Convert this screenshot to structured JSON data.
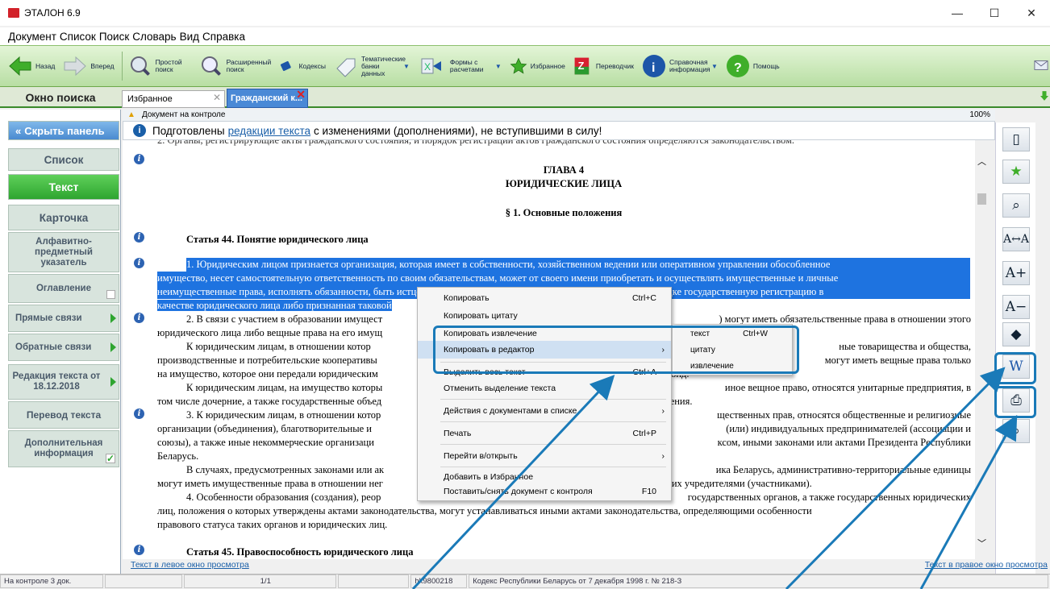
{
  "window": {
    "title": "ЭТАЛОН 6.9",
    "minimize": "—",
    "maximize": "☐",
    "close": "✕"
  },
  "menu": [
    "Документ",
    "Список",
    "Поиск",
    "Словарь",
    "Вид",
    "Справка"
  ],
  "toolbar": {
    "back": "Назад",
    "forward": "Вперед",
    "simple_search": "Простой поиск",
    "advanced_search": "Расширенный поиск",
    "codes": "Кодексы",
    "thematic": "Тематические банки данных",
    "forms": "Формы с расчетами",
    "favorites": "Избранное",
    "translator": "Переводчик",
    "reference": "Справочная информация",
    "help": "Помощь"
  },
  "tabs": {
    "search_window": "Окно поиска",
    "favorites": "Избранное",
    "civil": "Гражданский к..."
  },
  "left_panel": {
    "hide": "Скрыть панель",
    "list": "Список",
    "text": "Текст",
    "card": "Карточка",
    "alpha_index": "Алфавитно-предметный указатель",
    "contents": "Оглавление",
    "direct_links": "Прямые связи",
    "reverse_links": "Обратные связи",
    "edition": "Редакция текста от 18.12.2018",
    "translation": "Перевод текста",
    "additional": "Дополнительная информация"
  },
  "doc_header": {
    "label": "Документ на контроле",
    "zoom": "100%"
  },
  "info_bar": {
    "before": "Подготовлены",
    "link": "редакции текста",
    "after": "с изменениями (дополнениями), не вступившими в силу!"
  },
  "document": {
    "line0": "2. Органы, регистрирующие акты гражданского состояния, и порядок регистрации актов гражданского состояния определяются законодательством.",
    "chapter": "ГЛАВА 4",
    "chapter_title": "ЮРИДИЧЕСКИЕ ЛИЦА",
    "section": "§ 1. Основные положения",
    "art44": "Статья 44. Понятие юридического лица",
    "sel1": "1. Юридическим лицом признается организация, которая имеет в собственности, хозяйственном ведении или оперативном управлении обособленное",
    "sel2": "имущество, несет самостоятельную ответственность по своим обязательствам, может от своего имени приобретать и осуществлять имущественные и личные",
    "sel3": "неимущественные права, исполнять обязанности, быть истцом и ответчиком в суде, прошедшая в установленном порядке государственную регистрацию в",
    "sel4": "качестве юридического лица либо признанная таковой",
    "p2a": "2. В связи с участием в образовании имущест",
    "p2a_r": ") могут иметь обязательственные права в отношении этого",
    "p2b": "юридического лица либо вещные права на его имущ",
    "p3a": "К юридическим лицам, в отношении котор",
    "p3a_r": "ные товарищества и общества,",
    "p3b": "производственные и потребительские кооперативы",
    "p3b_r": "могут иметь вещные права только",
    "p3c": "на имущество, которое они передали юридическим",
    "p3c_r": "фонд.",
    "p4a": "К юридическим лицам, на имущество которы",
    "p4a_r": "иное вещное право, относятся унитарные предприятия, в",
    "p4b": "том числе дочерние, а также государственные объед",
    "p4b_r": "нения.",
    "p5a": "3. К юридическим лицам, в отношении котор",
    "p5a_r": "щественных прав, относятся общественные и религиозные",
    "p5b": "организации (объединения), благотворительные и",
    "p5b_r": "(или) индивидуальных предпринимателей (ассоциации и",
    "p5c": "союзы), а также иные некоммерческие организаци",
    "p5c_r": "ксом, иными законами или актами Президента Республики",
    "p5d": "Беларусь.",
    "p6a": "В случаях, предусмотренных законами или ак",
    "p6a_r": "ика Беларусь, административно-территориальные единицы",
    "p6b": "могут иметь имущественные права в отношении нег",
    "p6b_r": "ь их учредителями (участниками).",
    "p7a": "4. Особенности образования (создания), реор",
    "p7a_r": "государственных органов, а также государственных юридических",
    "p7b": "лиц, положения о которых утверждены актами законодательства, могут устанавливаться иными актами законодательства, определяющими особенности",
    "p7c": "правового статуса таких органов и юридических лиц.",
    "art45": "Статья 45. Правоспособность юридического лица"
  },
  "context_menu": {
    "copy": "Копировать",
    "copy_sc": "Ctrl+C",
    "copy_quote": "Копировать цитату",
    "copy_extract": "Копировать извлечение",
    "copy_to_editor": "Копировать в редактор",
    "select_all": "Выделить весь текст",
    "select_all_sc": "Ctrl+A",
    "deselect": "Отменить выделение текста",
    "actions": "Действия с документами в списке",
    "print": "Печать",
    "print_sc": "Ctrl+P",
    "goto": "Перейти в/открыть",
    "add_fav": "Добавить в Избранное",
    "control": "Поставить/снять документ с контроля",
    "control_sc": "F10"
  },
  "submenu": {
    "text": "текст",
    "text_sc": "Ctrl+W",
    "quote": "цитату",
    "extract": "извлечение"
  },
  "footer": {
    "left_view": "Текст в левое окно просмотра",
    "right_view": "Текст в правое окно просмотра"
  },
  "status": {
    "control": "На контроле 3 док.",
    "page": "1/1",
    "code": "hk9800218",
    "doc": "Кодекс Республики Беларусь от 7 декабря 1998 г. № 218-З"
  },
  "colors": {
    "accent_green": "#2ea530",
    "selection": "#1e73e0",
    "highlight": "#1a7ab8"
  }
}
